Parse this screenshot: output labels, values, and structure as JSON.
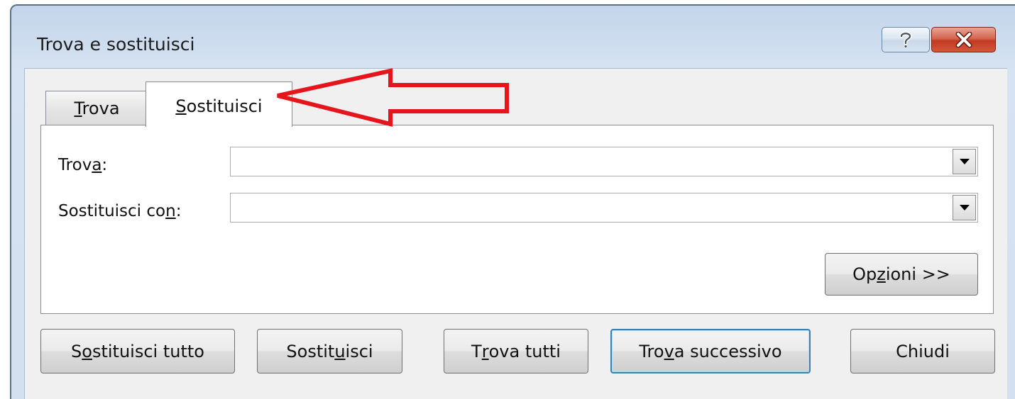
{
  "window": {
    "title": "Trova e sostituisci",
    "help_glyph": "?",
    "close_glyph": "X"
  },
  "tabs": [
    {
      "label": "Trova",
      "access_key": "T",
      "rest": "rova",
      "selected": false
    },
    {
      "label": "Sostituisci",
      "access_key": "S",
      "rest": "ostituisci",
      "selected": true
    }
  ],
  "find": {
    "label_before": "Trov",
    "label_key": "a",
    "label_after": ":",
    "value": ""
  },
  "replace": {
    "label_before": "Sostituisci co",
    "label_key": "n",
    "label_after": ":",
    "value": ""
  },
  "options_button": {
    "before": "Op",
    "key": "z",
    "after": "ioni >>"
  },
  "buttons": {
    "replace_all": {
      "before": "S",
      "key": "o",
      "after": "stituisci tutto"
    },
    "replace": {
      "before": "Sostit",
      "key": "u",
      "after": "isci"
    },
    "find_all": {
      "before": "T",
      "key": "r",
      "after": "ova tutti"
    },
    "find_next": {
      "before": "Tro",
      "key": "v",
      "after": "a successivo"
    },
    "close": {
      "label": "Chiudi"
    }
  },
  "annotation": {
    "color": "#e8141c",
    "icon": "arrow-left"
  },
  "colors": {
    "frame": "#cfdeef",
    "close_button": "#c9432a",
    "default_button_border": "#3c7fb1"
  }
}
